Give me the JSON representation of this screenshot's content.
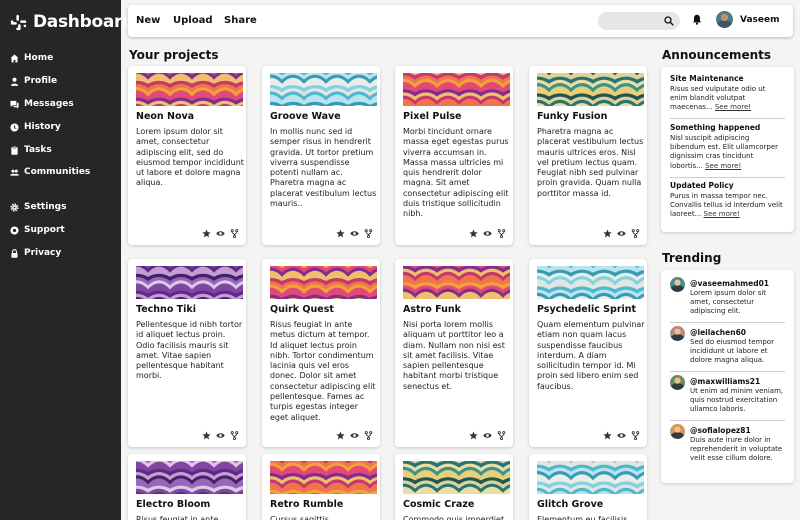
{
  "app": {
    "title": "Dashboard"
  },
  "sidebar": {
    "items": [
      {
        "label": "Home",
        "icon": "home-icon"
      },
      {
        "label": "Profile",
        "icon": "user-icon"
      },
      {
        "label": "Messages",
        "icon": "messages-icon"
      },
      {
        "label": "History",
        "icon": "clock-icon"
      },
      {
        "label": "Tasks",
        "icon": "clipboard-icon"
      },
      {
        "label": "Communities",
        "icon": "users-icon"
      },
      {
        "label": "Settings",
        "icon": "gear-icon"
      },
      {
        "label": "Support",
        "icon": "support-icon"
      },
      {
        "label": "Privacy",
        "icon": "lock-icon"
      }
    ]
  },
  "topbar": {
    "links": [
      "New",
      "Upload",
      "Share"
    ],
    "search_placeholder": "",
    "username": "Vaseem"
  },
  "projects": {
    "title": "Your projects",
    "cards": [
      {
        "title": "Neon Nova",
        "text": "Lorem ipsum dolor sit amet, consectetur adipiscing elit, sed do eiusmod tempor incididunt ut labore et dolore magna aliqua.",
        "palette": "warm"
      },
      {
        "title": "Groove Wave",
        "text": "In mollis nunc sed id semper risus in hendrerit gravida. Ut tortor pretium viverra suspendisse potenti nullam ac. Pharetra magna ac placerat vestibulum lectus mauris..",
        "palette": "aqua"
      },
      {
        "title": "Pixel Pulse",
        "text": "Morbi tincidunt ornare massa eget egestas purus viverra accumsan in. Massa massa ultricies mi quis hendrerit dolor magna. Sit amet consectetur adipiscing elit duis tristique sollicitudin nibh.",
        "palette": "warm"
      },
      {
        "title": "Funky Fusion",
        "text": "Pharetra magna ac placerat vestibulum lectus mauris ultrices eros. Nisl vel pretium lectus quam. Feugiat nibh sed pulvinar proin gravida. Quam nulla porttitor massa id.",
        "palette": "teal"
      },
      {
        "title": "Techno Tiki",
        "text": "Pellentesque id nibh tortor id aliquet lectus proin. Odio facilisis mauris sit amet. Vitae sapien pellentesque habitant morbi.",
        "palette": "purple"
      },
      {
        "title": "Quirk Quest",
        "text": "Risus feugiat in ante metus dictum at tempor. Id aliquet lectus proin nibh. Tortor condimentum lacinia quis vel eros donec. Dolor sit amet consectetur adipiscing elit pellentesque. Fames ac turpis egestas integer eget aliquet.",
        "palette": "warm"
      },
      {
        "title": "Astro Funk",
        "text": "Nisi porta lorem mollis aliquam ut porttitor leo a diam. Nullam non nisi est sit amet facilisis. Vitae sapien pellentesque habitant morbi tristique senectus et.",
        "palette": "warm"
      },
      {
        "title": "Psychedelic Sprint",
        "text": "Quam elementum pulvinar etiam non quam lacus suspendisse faucibus interdum. A diam sollicitudin tempor id. Mi proin sed libero enim sed faucibus.",
        "palette": "aqua"
      },
      {
        "title": "Electro Bloom",
        "text": "Risus feugiat in ante",
        "palette": "purple"
      },
      {
        "title": "Retro Rumble",
        "text": "Cursus sagittis",
        "palette": "warm"
      },
      {
        "title": "Cosmic Craze",
        "text": "Commodo quis imperdiet",
        "palette": "teal"
      },
      {
        "title": "Glitch Grove",
        "text": "Elementum eu facilisis",
        "palette": "aqua"
      }
    ]
  },
  "announcements": {
    "title": "Announcements",
    "more_label": "See more!",
    "items": [
      {
        "title": "Site Maintenance",
        "text": "Risus sed vulputate odio ut enim blandit volutpat maecenas..."
      },
      {
        "title": "Something happened",
        "text": "Nisl suscipit adipiscing bibendum est. Elit ullamcorper dignissim cras tincidunt lobortis..."
      },
      {
        "title": "Updated Policy",
        "text": "Purus in massa tempor nec. Convallis tellus id interdum velit laoreet..."
      }
    ]
  },
  "trending": {
    "title": "Trending",
    "items": [
      {
        "handle": "@vaseemahmed01",
        "text": "Lorem ipsum dolor sit amet, consectetur adipiscing elit.",
        "avatar_color": "#4f8a8b"
      },
      {
        "handle": "@leilachen60",
        "text": "Sed do eiusmod tempor incididunt ut labore et dolore magna aliqua.",
        "avatar_color": "#b9897a"
      },
      {
        "handle": "@maxwilliams21",
        "text": "Ut enim ad minim veniam, quis nostrud exercitation ullamco laboris.",
        "avatar_color": "#6c8a5a"
      },
      {
        "handle": "@sofialopez81",
        "text": "Duis aute irure dolor in reprehenderit in voluptate velit esse cillum dolore.",
        "avatar_color": "#d9944f"
      }
    ]
  },
  "colors": {
    "sidebar": "#262626",
    "page": "#f4f4f4",
    "card": "#ffffff"
  }
}
